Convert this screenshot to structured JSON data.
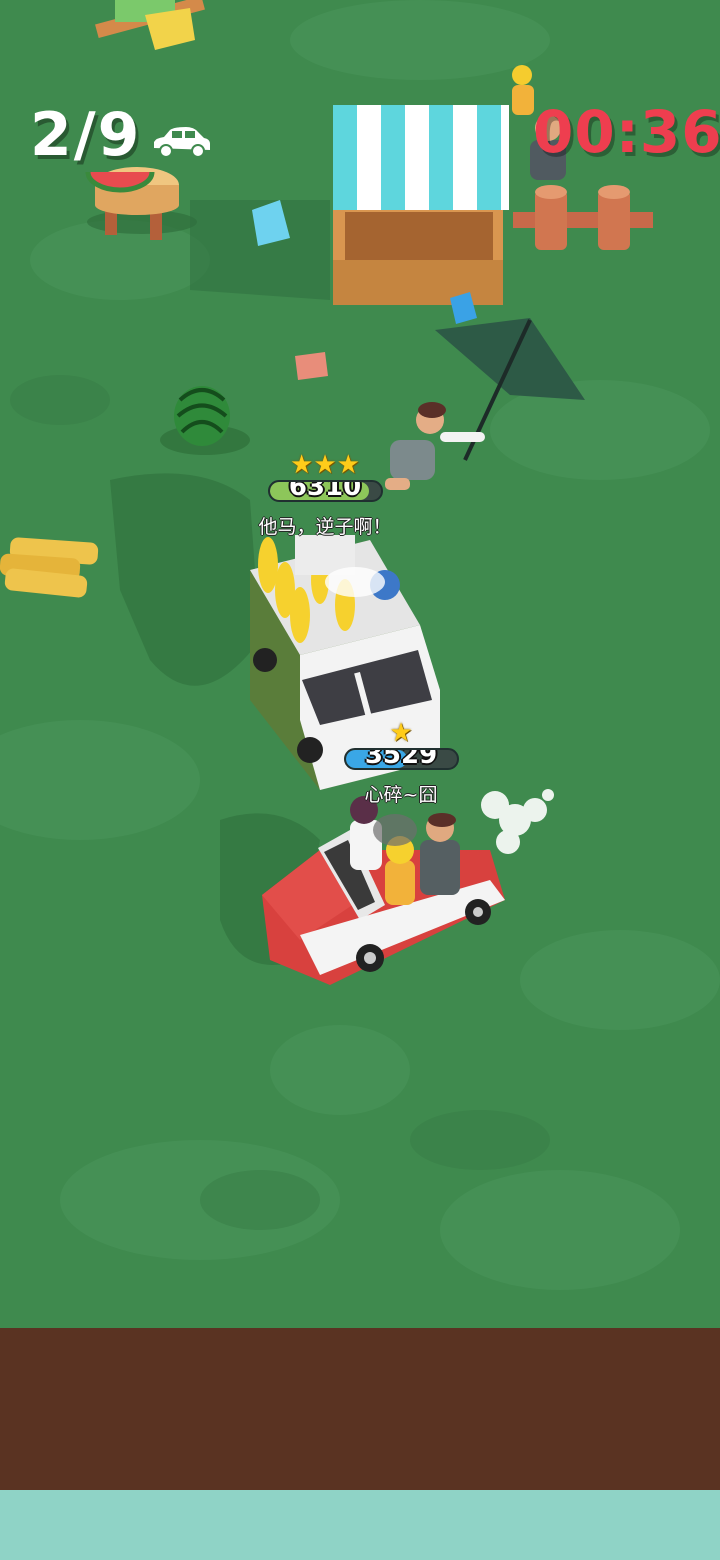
{
  "hud": {
    "cars_progress": "2/9",
    "timer": "00:36",
    "car_icon": "car-icon"
  },
  "players": [
    {
      "id": "opponent",
      "stars": "★★★",
      "score": "6310",
      "name": "他马，逆子啊！",
      "bar_color": "#8dc65a",
      "fill_fraction": 0.9
    },
    {
      "id": "player",
      "stars": "★",
      "score": "3529",
      "name": "心碎~囧",
      "bar_color": "#3aa7e6",
      "fill_fraction": 0.55
    }
  ],
  "colors": {
    "grass": "#3f8a4e",
    "dirt": "#5a3322",
    "water": "#8fd3c6",
    "timer": "#ee3e4f"
  }
}
